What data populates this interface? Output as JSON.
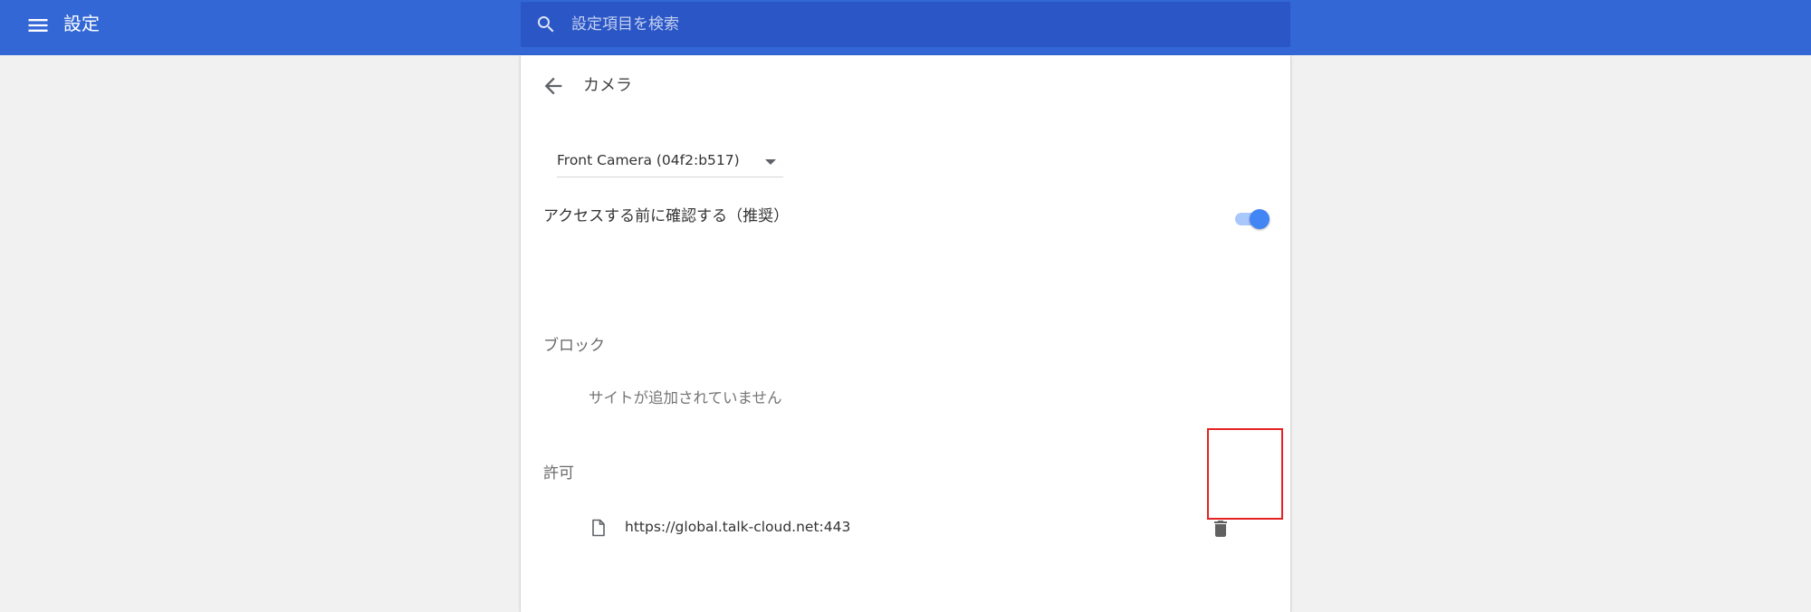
{
  "header": {
    "title": "設定",
    "menu_icon": "hamburger-menu-icon",
    "search": {
      "placeholder": "設定項目を検索",
      "value": "",
      "icon": "search-icon"
    },
    "background_color": "#3367d6",
    "search_background_color": "#2a56c6"
  },
  "page": {
    "back_icon": "arrow-back-icon",
    "title": "カメラ",
    "camera_select": {
      "selected": "Front Camera (04f2:b517)"
    },
    "ask_before_access": {
      "label": "アクセスする前に確認する（推奨）",
      "enabled": true
    },
    "block_section": {
      "heading": "ブロック",
      "empty_text": "サイトが追加されていません"
    },
    "allow_section": {
      "heading": "許可",
      "sites": [
        {
          "url": "https://global.talk-cloud.net:443",
          "icon": "file-icon",
          "action_icon": "trash-delete-icon"
        }
      ]
    }
  },
  "colors": {
    "accent": "#4285f4",
    "highlight_annotation": "#e52222"
  }
}
